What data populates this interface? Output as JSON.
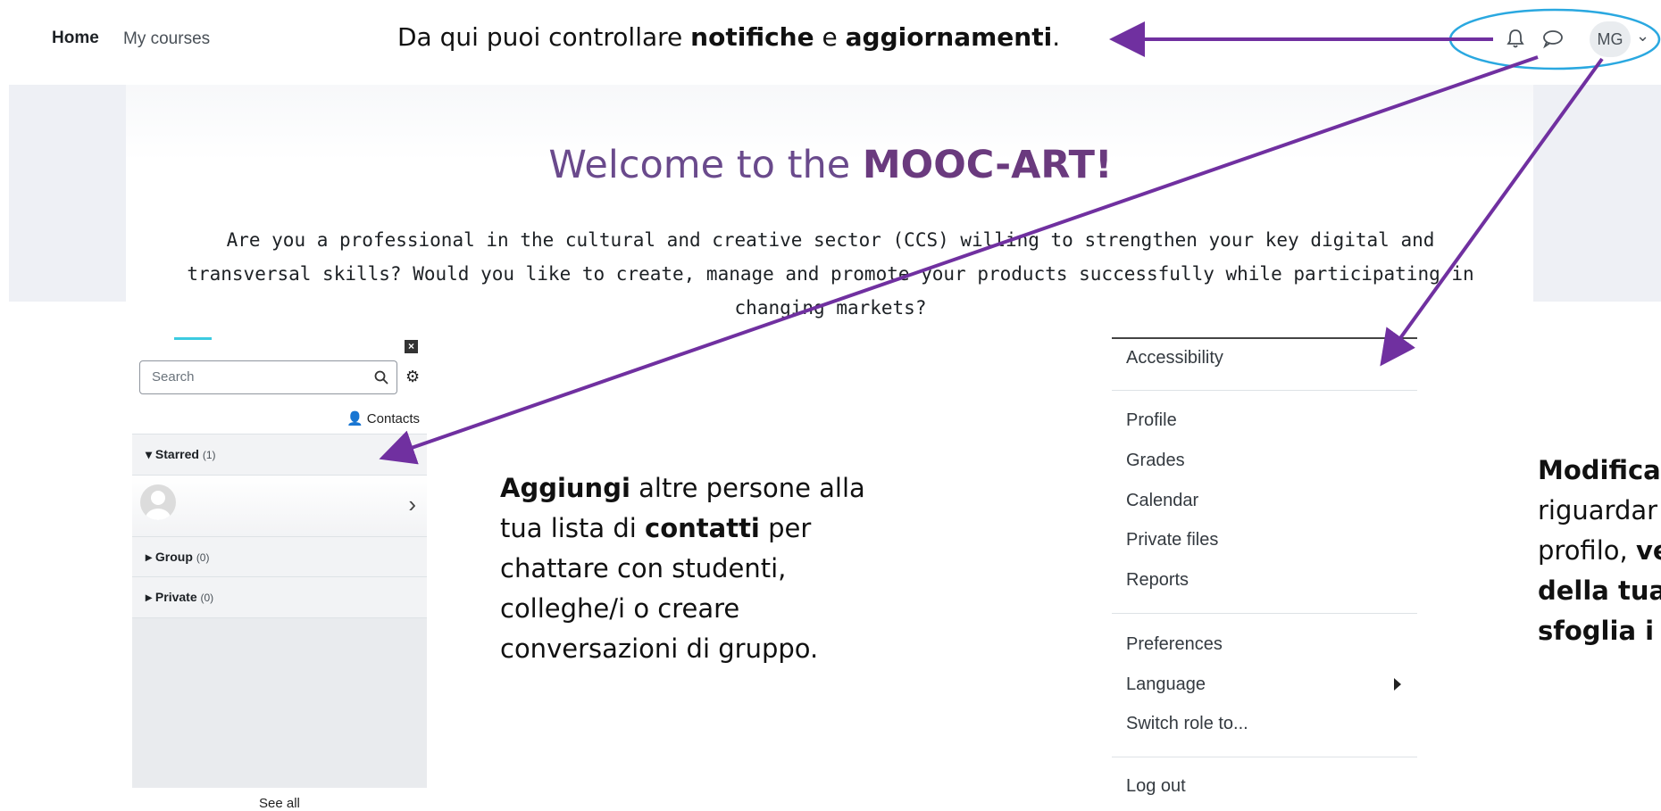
{
  "navbar": {
    "home": "Home",
    "my_courses": "My courses",
    "avatar_initials": "MG",
    "icons": [
      "bell-icon",
      "chat-bubble-icon",
      "chevron-down-icon"
    ]
  },
  "annotation_top": {
    "prefix": "Da qui puoi controllare ",
    "bold1": "notifiche",
    "mid": " e ",
    "bold2": "aggiornamenti",
    "suffix": "."
  },
  "hero": {
    "title_prefix": "Welcome to the ",
    "title_bold": "MOOC-ART!",
    "text": "Are you a professional in the cultural and creative sector (CCS) willing to strengthen your key digital and transversal skills? Would you like to create, manage and promote your products successfully while participating in changing markets?"
  },
  "drawer": {
    "search_placeholder": "Search",
    "contacts_label": "Contacts",
    "sections": [
      {
        "label": "Starred",
        "count": "(1)"
      },
      {
        "label": "Group",
        "count": "(0)"
      },
      {
        "label": "Private",
        "count": "(0)"
      }
    ],
    "see_all": "See all"
  },
  "annotation_mid": {
    "bold1": "Aggiungi",
    "line1_rest": " altre persone alla",
    "line2_pre": "tua lista di ",
    "bold2": "contatti",
    "line2_rest": " per",
    "line3": "chattare con studenti,",
    "line4": "colleghe/i o creare",
    "line5": "conversazioni di gruppo."
  },
  "user_menu": {
    "items": [
      "Accessibility",
      "Profile",
      "Grades",
      "Calendar",
      "Private files",
      "Reports",
      "Preferences",
      "Language",
      "Switch role to...",
      "Log out"
    ]
  },
  "annotation_right": {
    "line1_bold": "Modifica",
    "line2": "riguardar",
    "line3_pre": "profilo, ",
    "line3_bold": "ve",
    "line4_bold": "della tua",
    "line5_bold": "sfoglia i f"
  },
  "colors": {
    "arrow": "#7030a0",
    "ellipse": "#2aa8e0",
    "hero_title": "#6a4a8c"
  }
}
